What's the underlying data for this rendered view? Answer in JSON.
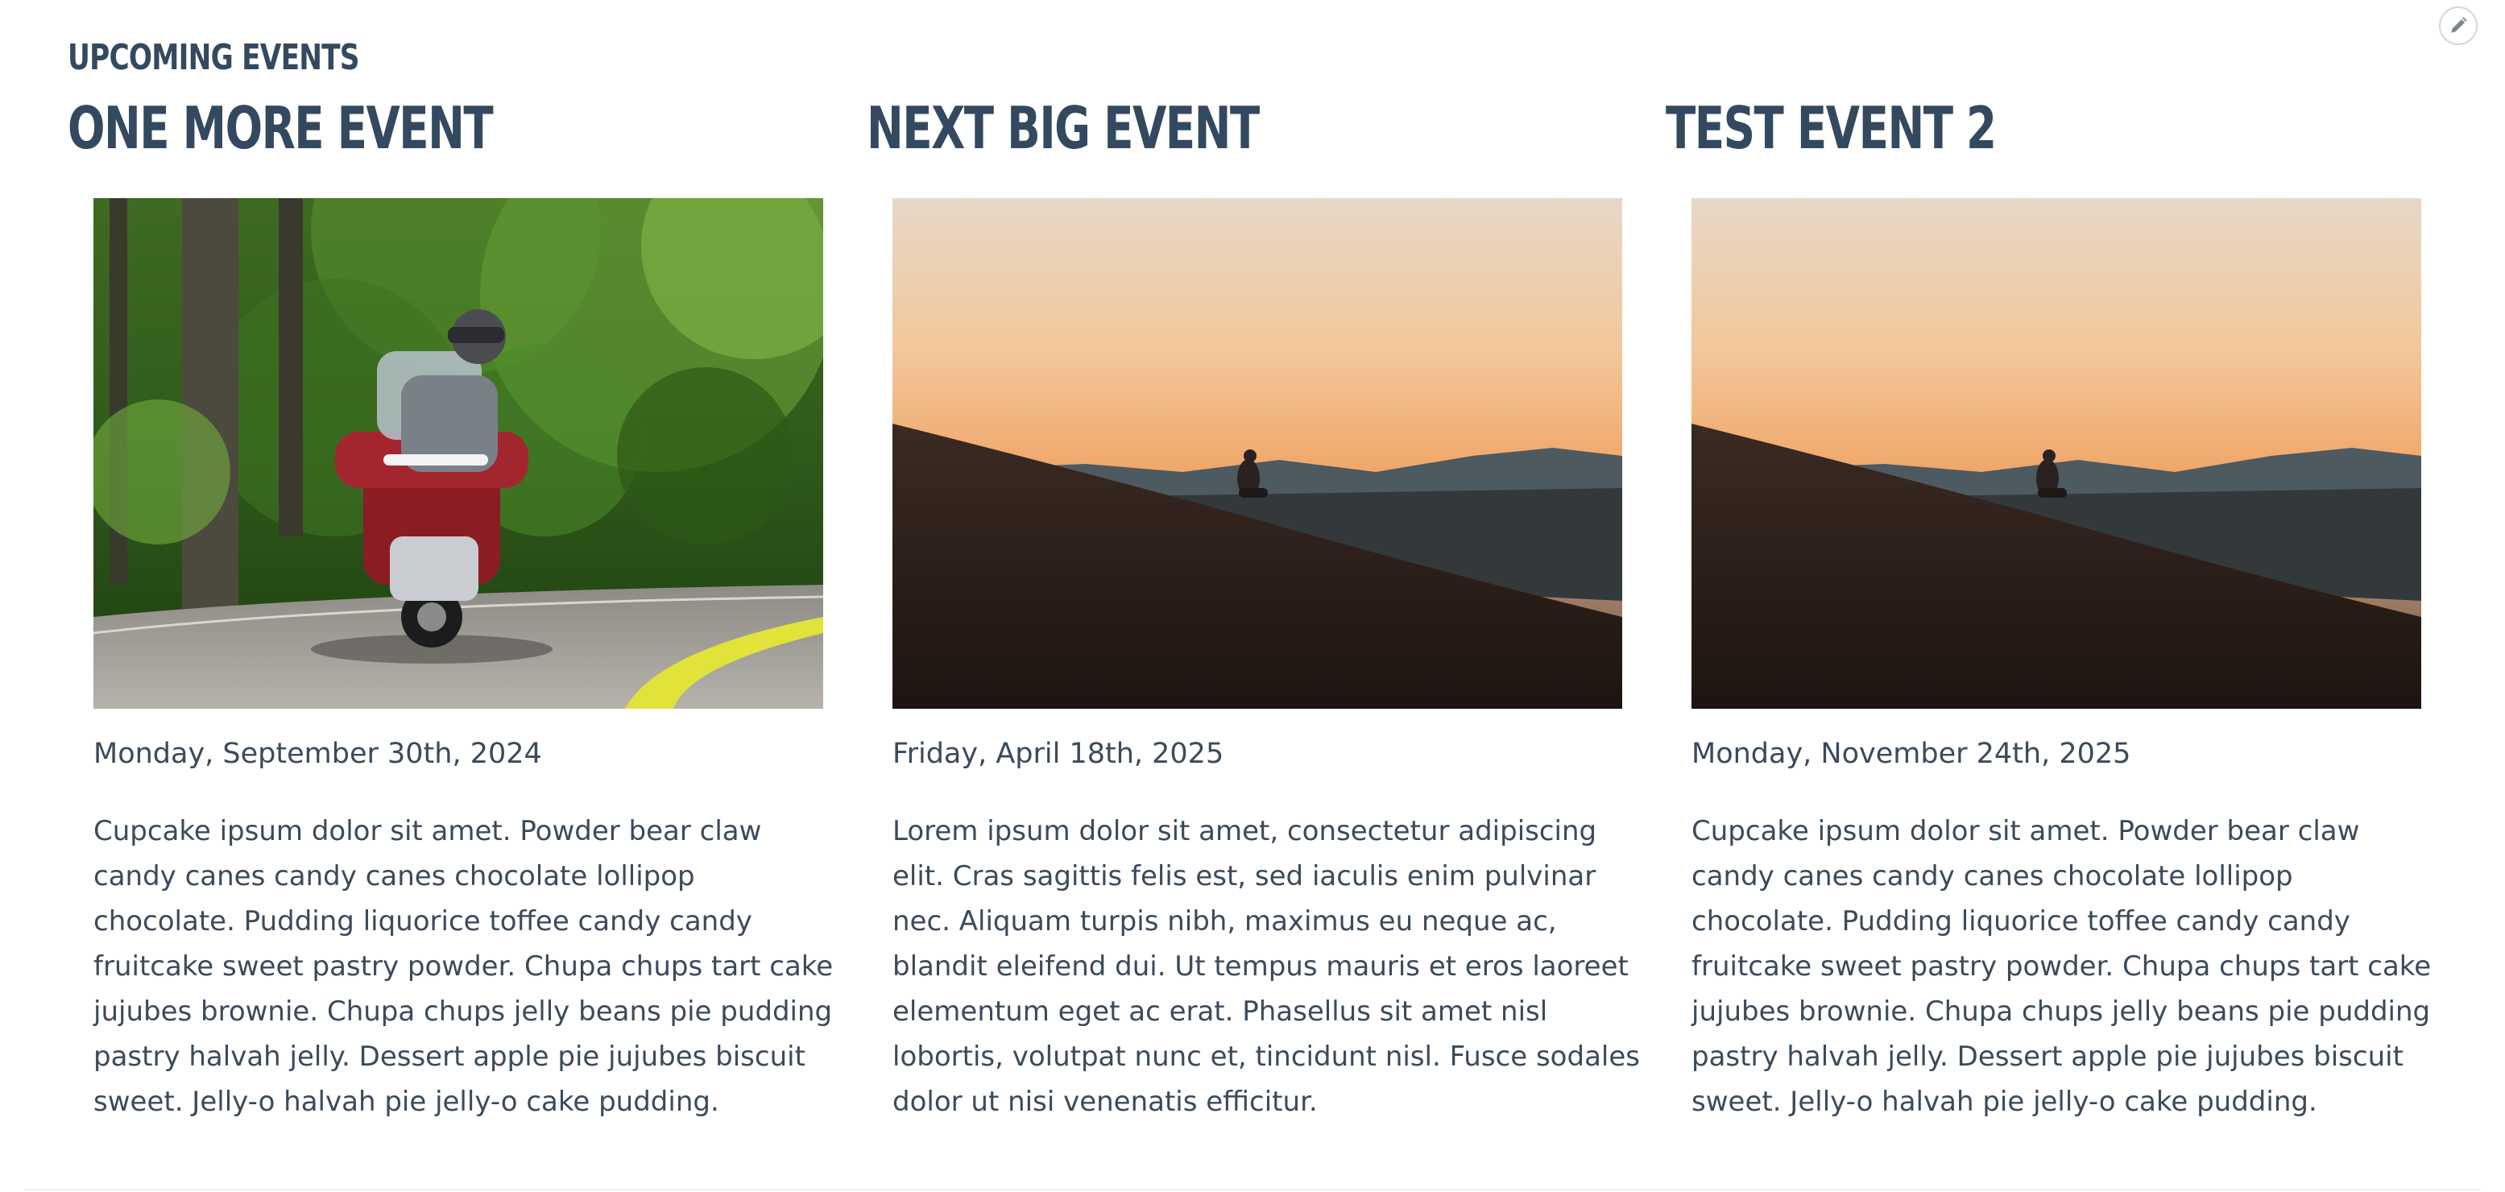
{
  "section": {
    "label": "UPCOMING EVENTS"
  },
  "edit": {
    "icon": "pencil-icon"
  },
  "events": [
    {
      "title": "ONE MORE EVENT",
      "date": "Monday, September 30th, 2024",
      "description": "Cupcake ipsum dolor sit amet. Powder bear claw candy canes candy canes chocolate lollipop chocolate. Pudding liquorice toffee candy candy fruitcake sweet pastry powder. Chupa chups tart cake jujubes brownie. Chupa chups jelly beans pie pudding pastry halvah jelly. Dessert apple pie jujubes biscuit sweet. Jelly-o halvah pie jelly-o cake pudding."
    },
    {
      "title": "NEXT BIG EVENT",
      "date": "Friday, April 18th, 2025",
      "description": "Lorem ipsum dolor sit amet, consectetur adipiscing elit. Cras sagittis felis est, sed iaculis enim pulvinar nec. Aliquam turpis nibh, maximus eu neque ac, blandit eleifend dui. Ut tempus mauris et eros laoreet elementum eget ac erat. Phasellus sit amet nisl lobortis, volutpat nunc et, tincidunt nisl. Fusce sodales dolor ut nisi venenatis efficitur."
    },
    {
      "title": "TEST EVENT 2",
      "date": "Monday, November 24th, 2025",
      "description": "Cupcake ipsum dolor sit amet. Powder bear claw candy canes candy canes chocolate lollipop chocolate. Pudding liquorice toffee candy candy fruitcake sweet pastry powder. Chupa chups tart cake jujubes brownie. Chupa chups jelly beans pie pudding pastry halvah jelly. Dessert apple pie jujubes biscuit sweet. Jelly-o halvah pie jelly-o cake pudding."
    }
  ]
}
